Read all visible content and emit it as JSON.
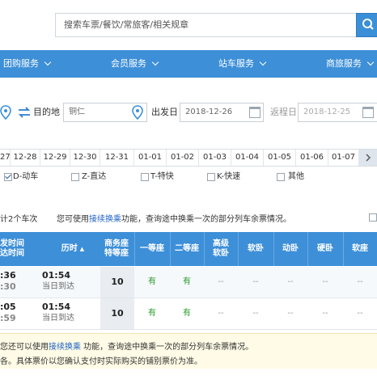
{
  "search": {
    "placeholder": "搜索车票/餐饮/常旅客/相关规章"
  },
  "nav": {
    "items": [
      {
        "label": "团购服务"
      },
      {
        "label": "会员服务"
      },
      {
        "label": "站车服务"
      },
      {
        "label": "商旅服务"
      }
    ]
  },
  "form": {
    "to_label": "目的地",
    "to_value": "铜仁",
    "depart_label": "出发日",
    "depart_value": "2018-12-26",
    "return_label": "返程日",
    "return_value": "2018-12-25"
  },
  "dates": [
    "27",
    "12-28",
    "12-29",
    "12-30",
    "12-31",
    "01-01",
    "01-02",
    "01-03",
    "01-04",
    "01-05",
    "01-06",
    "01-07"
  ],
  "filters": [
    {
      "label": "D-动车",
      "checked": true
    },
    {
      "label": "Z-直达",
      "checked": false
    },
    {
      "label": "T-特快",
      "checked": false
    },
    {
      "label": "K-快速",
      "checked": false
    },
    {
      "label": "其他",
      "checked": false
    }
  ],
  "info": {
    "count_text": "计2个车次",
    "hint_prefix": "您可使用",
    "hint_link": "接续换乘",
    "hint_suffix": "功能，查询途中换乘一次的部分列车余票情况。"
  },
  "table": {
    "headers": {
      "time_top": "发时间",
      "time_bottom": "达时间",
      "duration": "历时",
      "business_top": "商务座",
      "business_bottom": "特等座",
      "first": "一等座",
      "second": "二等座",
      "sleeper_top": "高级",
      "sleeper_bottom": "软卧",
      "soft_sleeper": "软卧",
      "moving_sleeper": "动卧",
      "hard_sleeper": "硬卧",
      "soft_seat": "软座"
    },
    "rows": [
      {
        "depart_time": ":36",
        "arrive_time": ":30",
        "duration": "01:54",
        "arrival_note": "当日到达",
        "business": "10",
        "first": "有",
        "second": "有",
        "other": [
          "--",
          "--",
          "--",
          "--",
          "--"
        ]
      },
      {
        "depart_time": ":05",
        "arrive_time": ":59",
        "duration": "01:54",
        "arrival_note": "当日到达",
        "business": "10",
        "first": "有",
        "second": "有",
        "other": [
          "--",
          "--",
          "--",
          "--",
          "--"
        ]
      }
    ]
  },
  "notice": {
    "line1_prefix": "您还可以使用",
    "line1_link": "接续换乘",
    "line1_suffix": " 功能，查询途中换乘一次的部分列车余票情况。",
    "line2": "各。具体票价以您确认支付时实际购买的铺别票价为准。"
  },
  "colors": {
    "nav_blue": "#3d8fd8",
    "link_blue": "#1f63c6",
    "available_green": "#2a9a2a"
  }
}
